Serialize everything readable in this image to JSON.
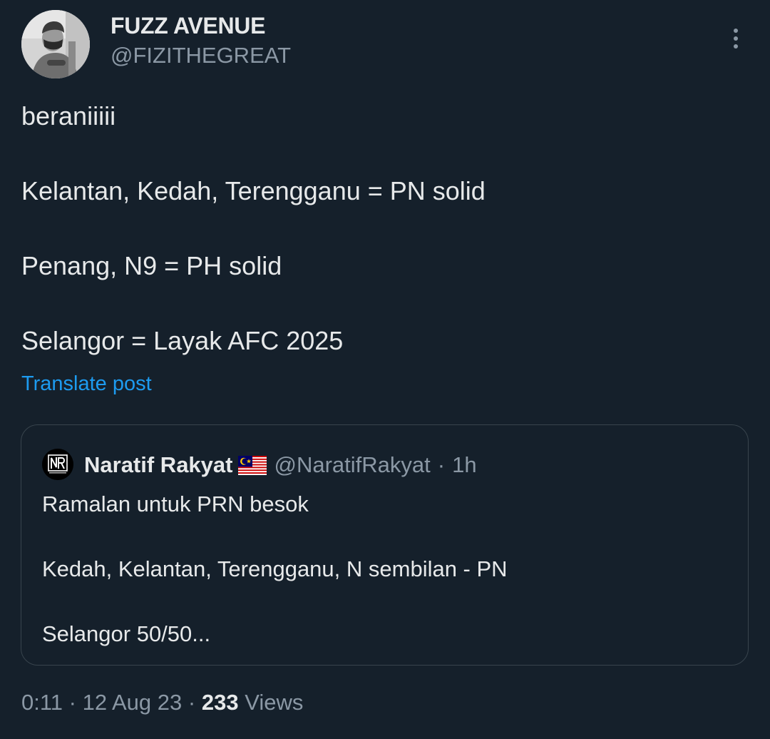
{
  "author": {
    "display_name": "FUZZ AVENUE",
    "handle": "@FIZITHEGREAT",
    "avatar": "profile-photo"
  },
  "more_icon": "more-vertical-icon",
  "post": {
    "text": "beraniiiii\n\nKelantan, Kedah, Terengganu = PN solid\n\nPenang, N9 = PH solid\n\nSelangor = Layak AFC 2025",
    "translate_label": "Translate post"
  },
  "quoted": {
    "avatar": "naratif-rakyat-logo",
    "display_name": "Naratif Rakyat",
    "flag_icon": "malaysia-flag-icon",
    "handle": "@NaratifRakyat",
    "separator": "·",
    "time": "1h",
    "text": "Ramalan untuk PRN besok\n\nKedah, Kelantan, Terengganu, N sembilan - PN\n\nSelangor 50/50..."
  },
  "meta": {
    "time": "0:11",
    "date": "12 Aug 23",
    "separator": "·",
    "views_count": "233",
    "views_label": "Views"
  },
  "colors": {
    "background": "#15202b",
    "text_primary": "#e7e9ea",
    "text_secondary": "#8b98a5",
    "link": "#1d9bf0",
    "border": "#38444d"
  }
}
